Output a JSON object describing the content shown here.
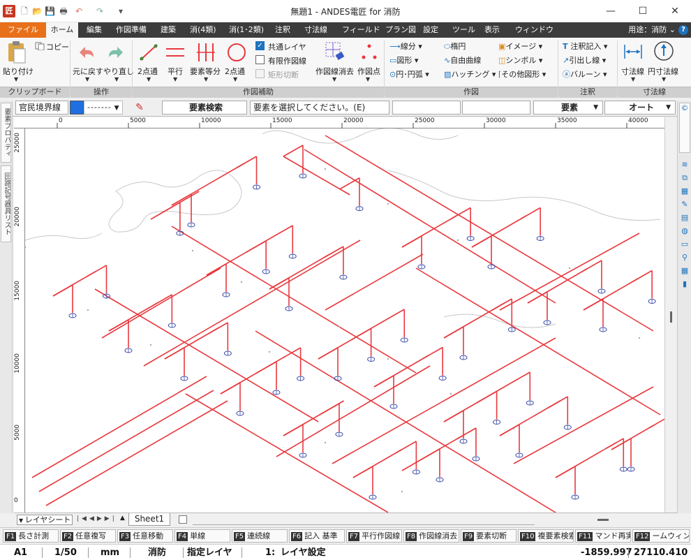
{
  "window": {
    "app_icon_text": "匠",
    "title": "無題1 - ANDES電匠 for 消防",
    "minimize": "—",
    "maximize": "☐",
    "close": "✕"
  },
  "quick_access": {
    "icons": [
      "new-file-icon",
      "open-folder-icon",
      "save-icon",
      "print-icon",
      "undo-icon",
      "redo-icon",
      "customize-icon"
    ]
  },
  "menubar": {
    "tabs": [
      "ファイル",
      "ホーム",
      "編集",
      "作図準備",
      "建築",
      "消(4類)",
      "消(1･2類)",
      "注釈",
      "寸法線",
      "フィールド",
      "プラン図",
      "設定",
      "ツール",
      "表示",
      "ウィンドウ"
    ],
    "usage": "用途：消防 ⌄",
    "help": "?"
  },
  "ribbon": {
    "clipboard": {
      "paste": "貼り付け",
      "copy": "コピー",
      "label": "クリップボード"
    },
    "operation": {
      "undo": "元に戻す",
      "redo": "やり直し",
      "label": "操作"
    },
    "drawing_aid": {
      "two_point": "2点通",
      "parallel": "平行",
      "equal_div": "要素等分",
      "circle_two_point": "2点通",
      "shared_layer": "共通レイヤ",
      "limited_aux": "有限作図線",
      "rect_cut": "矩形切断",
      "erase_aux": "作図線消去",
      "aux_point": "作図点",
      "label": "作図補助"
    },
    "drawing": {
      "line": "線分",
      "shape": "図形",
      "circle_arc": "円･円弧",
      "ellipse": "楕円",
      "free_curve": "自由曲線",
      "hatching": "ハッチング",
      "image": "イメージ",
      "symbol": "シンボル",
      "other_shape": "その他図形",
      "label": "作図"
    },
    "annotation": {
      "note": "注釈記入",
      "leader": "引出し線",
      "balloon": "バルーン",
      "label": "注釈"
    },
    "dimension": {
      "dim_line": "寸法線",
      "circle_dim": "円寸法線",
      "label": "寸法線"
    }
  },
  "cmdbar": {
    "layer": "官民境界線",
    "line_style": "-------",
    "mode": "要素検索",
    "prompt": "要素を選択してください。(E)",
    "filter": "要素",
    "snap": "オート"
  },
  "left_tabs": [
    "要素プロパティ",
    "回路記号器具リスト"
  ],
  "ruler_top": [
    "0",
    "5000",
    "10000",
    "15000",
    "20000",
    "25000",
    "30000",
    "35000",
    "40000"
  ],
  "ruler_left": [
    "25000",
    "20000",
    "15000",
    "10000",
    "5000",
    "0"
  ],
  "sheetbar": {
    "layer_sheet": "レイヤシート",
    "sheet_name": "Sheet1"
  },
  "fkeys": [
    {
      "key": "F1",
      "label": "長さ計測"
    },
    {
      "key": "F2",
      "label": "任意複写"
    },
    {
      "key": "F3",
      "label": "任意移動"
    },
    {
      "key": "F4",
      "label": "単線"
    },
    {
      "key": "F5",
      "label": "連続線"
    },
    {
      "key": "F6",
      "label": "記入 基準"
    },
    {
      "key": "F7",
      "label": "平行作図線"
    },
    {
      "key": "F8",
      "label": "作図線消去"
    },
    {
      "key": "F9",
      "label": "要素切断"
    },
    {
      "key": "F10",
      "label": "複要素検索"
    },
    {
      "key": "F11",
      "label": "マンド再実"
    },
    {
      "key": "F12",
      "label": "ームウィンド"
    }
  ],
  "status": {
    "paper": "A1",
    "scale": "1/50",
    "unit": "mm",
    "usage": "消防",
    "layer_mode": "指定レイヤ",
    "layer_no": "1:",
    "layer_setting": "レイヤ設定",
    "coord_x": "-1859.997",
    "coord_y": "27110.410"
  },
  "drawing_colors": {
    "pipe": "#e8383d",
    "head": "#3a4aa8",
    "boundary": "#c8c8c8",
    "dim_text": "#aaaaaa"
  }
}
